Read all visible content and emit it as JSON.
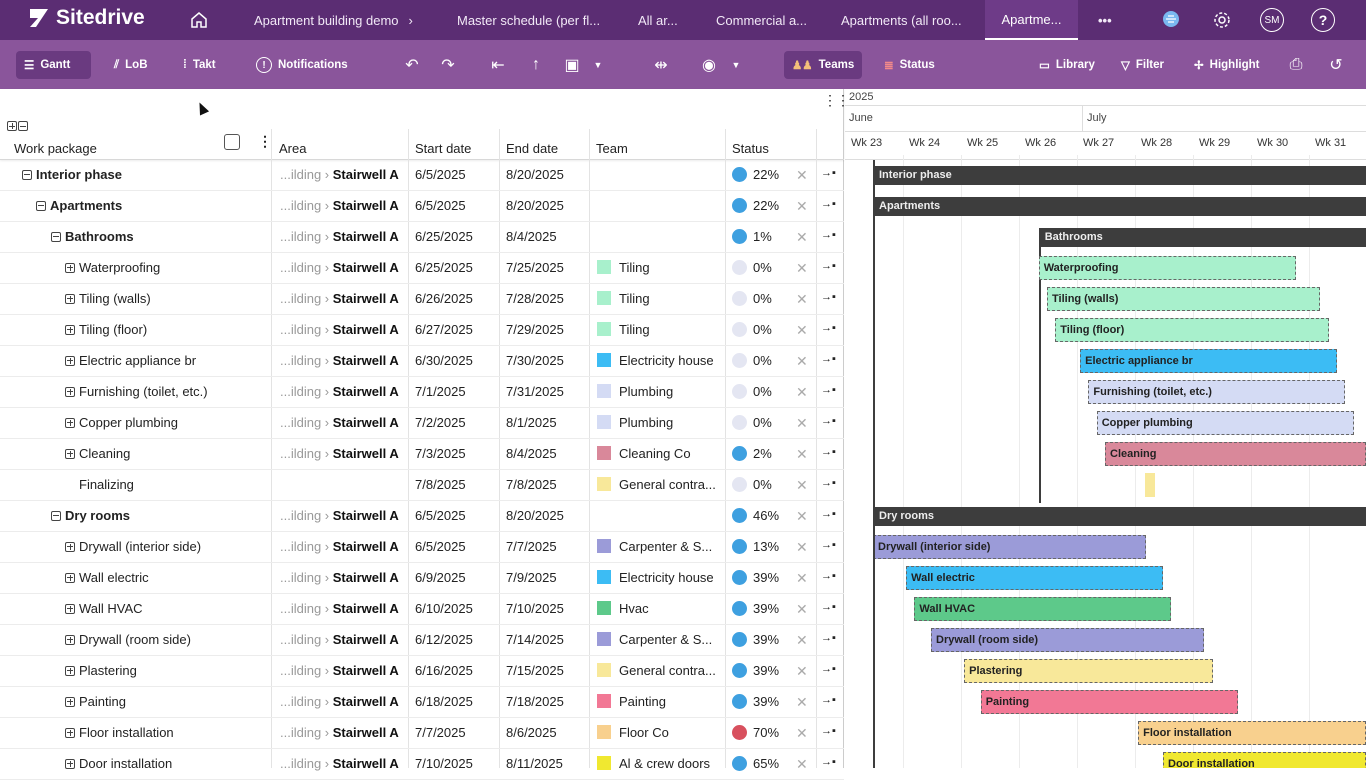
{
  "app": {
    "name": "Sitedrive"
  },
  "nav": {
    "tabs": [
      "Apartment building demo",
      "Master schedule (per fl...",
      "All ar...",
      "Commercial a...",
      "Apartments (all roo...",
      "Apartme..."
    ],
    "more": "•••",
    "avatar": "SM"
  },
  "toolbar": {
    "gantt": "Gantt",
    "lob": "LoB",
    "takt": "Takt",
    "notifications": "Notifications",
    "teams": "Teams",
    "status": "Status",
    "library": "Library",
    "filter": "Filter",
    "highlight": "Highlight"
  },
  "columns": {
    "work_package": "Work package",
    "area": "Area",
    "start": "Start date",
    "end": "End date",
    "team": "Team",
    "status": "Status"
  },
  "timeline": {
    "year": "2025",
    "months": [
      "June",
      "July"
    ],
    "weeks": [
      "Wk 23",
      "Wk 24",
      "Wk 25",
      "Wk 26",
      "Wk 27",
      "Wk 28",
      "Wk 29",
      "Wk 30",
      "Wk 31"
    ]
  },
  "rows": [
    {
      "name": "Interior phase",
      "level": 0,
      "group": true,
      "area_prefix": "...ilding ›",
      "area": "Stairwell A",
      "start": "6/5/2025",
      "end": "8/20/2025",
      "team": "",
      "team_color": "",
      "status": "22%",
      "status_color": "#3ea0e0"
    },
    {
      "name": "Apartments",
      "level": 1,
      "group": true,
      "area_prefix": "...ilding ›",
      "area": "Stairwell A",
      "start": "6/5/2025",
      "end": "8/20/2025",
      "team": "",
      "team_color": "",
      "status": "22%",
      "status_color": "#3ea0e0"
    },
    {
      "name": "Bathrooms",
      "level": 2,
      "group": true,
      "area_prefix": "...ilding ›",
      "area": "Stairwell A",
      "start": "6/25/2025",
      "end": "8/4/2025",
      "team": "",
      "team_color": "",
      "status": "1%",
      "status_color": "#3ea0e0"
    },
    {
      "name": "Waterproofing",
      "level": 3,
      "group": false,
      "area_prefix": "...ilding ›",
      "area": "Stairwell A",
      "start": "6/25/2025",
      "end": "7/25/2025",
      "team": "Tiling",
      "team_color": "#a8f0cc",
      "status": "0%",
      "status_color": "#e4e6f2"
    },
    {
      "name": "Tiling (walls)",
      "level": 3,
      "group": false,
      "area_prefix": "...ilding ›",
      "area": "Stairwell A",
      "start": "6/26/2025",
      "end": "7/28/2025",
      "team": "Tiling",
      "team_color": "#a8f0cc",
      "status": "0%",
      "status_color": "#e4e6f2"
    },
    {
      "name": "Tiling (floor)",
      "level": 3,
      "group": false,
      "area_prefix": "...ilding ›",
      "area": "Stairwell A",
      "start": "6/27/2025",
      "end": "7/29/2025",
      "team": "Tiling",
      "team_color": "#a8f0cc",
      "status": "0%",
      "status_color": "#e4e6f2"
    },
    {
      "name": "Electric appliance br",
      "level": 3,
      "group": false,
      "area_prefix": "...ilding ›",
      "area": "Stairwell A",
      "start": "6/30/2025",
      "end": "7/30/2025",
      "team": "Electricity house",
      "team_color": "#3cbcf4",
      "status": "0%",
      "status_color": "#e4e6f2"
    },
    {
      "name": "Furnishing (toilet, etc.)",
      "level": 3,
      "group": false,
      "area_prefix": "...ilding ›",
      "area": "Stairwell A",
      "start": "7/1/2025",
      "end": "7/31/2025",
      "team": "Plumbing",
      "team_color": "#d4dbf4",
      "status": "0%",
      "status_color": "#e4e6f2"
    },
    {
      "name": "Copper plumbing",
      "level": 3,
      "group": false,
      "area_prefix": "...ilding ›",
      "area": "Stairwell A",
      "start": "7/2/2025",
      "end": "8/1/2025",
      "team": "Plumbing",
      "team_color": "#d4dbf4",
      "status": "0%",
      "status_color": "#e4e6f2"
    },
    {
      "name": "Cleaning",
      "level": 3,
      "group": false,
      "area_prefix": "...ilding ›",
      "area": "Stairwell A",
      "start": "7/3/2025",
      "end": "8/4/2025",
      "team": "Cleaning Co",
      "team_color": "#d9889a",
      "status": "2%",
      "status_color": "#3ea0e0"
    },
    {
      "name": "Finalizing",
      "level": 3,
      "group": false,
      "noexp": true,
      "area_prefix": "",
      "area": "",
      "start": "7/8/2025",
      "end": "7/8/2025",
      "team": "General contra...",
      "team_color": "#f8e89a",
      "status": "0%",
      "status_color": "#e4e6f2"
    },
    {
      "name": "Dry rooms",
      "level": 2,
      "group": true,
      "area_prefix": "...ilding ›",
      "area": "Stairwell A",
      "start": "6/5/2025",
      "end": "8/20/2025",
      "team": "",
      "team_color": "",
      "status": "46%",
      "status_color": "#3ea0e0"
    },
    {
      "name": "Drywall (interior side)",
      "level": 3,
      "group": false,
      "area_prefix": "...ilding ›",
      "area": "Stairwell A",
      "start": "6/5/2025",
      "end": "7/7/2025",
      "team": "Carpenter & S...",
      "team_color": "#9b9bd8",
      "status": "13%",
      "status_color": "#3ea0e0"
    },
    {
      "name": "Wall electric",
      "level": 3,
      "group": false,
      "area_prefix": "...ilding ›",
      "area": "Stairwell A",
      "start": "6/9/2025",
      "end": "7/9/2025",
      "team": "Electricity house",
      "team_color": "#3cbcf4",
      "status": "39%",
      "status_color": "#3ea0e0"
    },
    {
      "name": "Wall HVAC",
      "level": 3,
      "group": false,
      "area_prefix": "...ilding ›",
      "area": "Stairwell A",
      "start": "6/10/2025",
      "end": "7/10/2025",
      "team": "Hvac",
      "team_color": "#5dc98a",
      "status": "39%",
      "status_color": "#3ea0e0"
    },
    {
      "name": "Drywall (room side)",
      "level": 3,
      "group": false,
      "area_prefix": "...ilding ›",
      "area": "Stairwell A",
      "start": "6/12/2025",
      "end": "7/14/2025",
      "team": "Carpenter & S...",
      "team_color": "#9b9bd8",
      "status": "39%",
      "status_color": "#3ea0e0"
    },
    {
      "name": "Plastering",
      "level": 3,
      "group": false,
      "area_prefix": "...ilding ›",
      "area": "Stairwell A",
      "start": "6/16/2025",
      "end": "7/15/2025",
      "team": "General contra...",
      "team_color": "#f8e89a",
      "status": "39%",
      "status_color": "#3ea0e0"
    },
    {
      "name": "Painting",
      "level": 3,
      "group": false,
      "area_prefix": "...ilding ›",
      "area": "Stairwell A",
      "start": "6/18/2025",
      "end": "7/18/2025",
      "team": "Painting",
      "team_color": "#f27895",
      "status": "39%",
      "status_color": "#3ea0e0"
    },
    {
      "name": "Floor installation",
      "level": 3,
      "group": false,
      "area_prefix": "...ilding ›",
      "area": "Stairwell A",
      "start": "7/7/2025",
      "end": "8/6/2025",
      "team": "Floor Co",
      "team_color": "#f8d08e",
      "status": "70%",
      "status_color": "#d8505e"
    },
    {
      "name": "Door installation",
      "level": 3,
      "group": false,
      "area_prefix": "...ilding ›",
      "area": "Stairwell A",
      "start": "7/10/2025",
      "end": "8/11/2025",
      "team": "Al & crew doors",
      "team_color": "#f0e830",
      "status": "65%",
      "status_color": "#3ea0e0"
    }
  ],
  "gantt_groups": [
    "Interior phase",
    "Apartments",
    "Bathrooms",
    "Dry rooms"
  ],
  "bathrooms_progress": "1%",
  "colors": {
    "nav": "#5b2d73",
    "toolbar": "#8a559b",
    "group_bar": "#3d3d3d"
  }
}
